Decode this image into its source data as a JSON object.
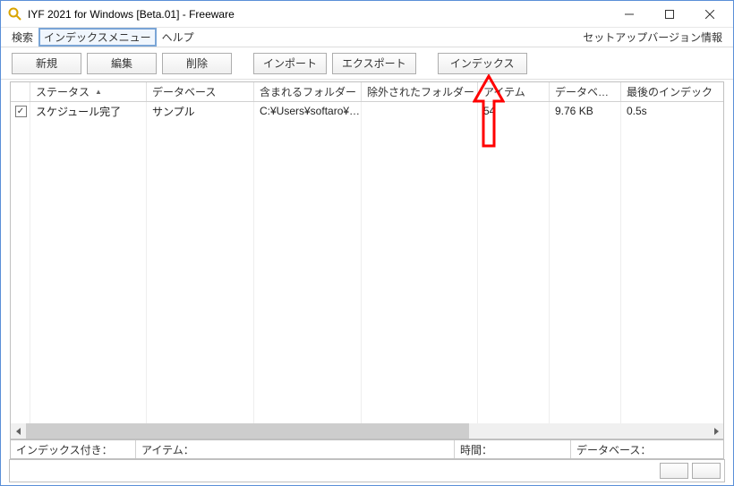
{
  "window": {
    "title": "IYF 2021 for Windows [Beta.01] - Freeware"
  },
  "menu": {
    "search": "検索",
    "index_menu": "インデックスメニュー",
    "help": "ヘルプ",
    "setup_version": "セットアップバージョン情報"
  },
  "toolbar": {
    "new": "新規",
    "edit": "編集",
    "delete": "削除",
    "import": "インポート",
    "export": "エクスポート",
    "index": "インデックス"
  },
  "columns": {
    "status": "ステータス",
    "database": "データベース",
    "included": "含まれるフォルダー",
    "excluded": "除外されたフォルダー",
    "items": "アイテム",
    "dbsize": "データベ…",
    "lastindex": "最後のインデック"
  },
  "row": {
    "checked": true,
    "status": "スケジュール完了",
    "database": "サンプル",
    "included": "C:¥Users¥softaro¥…",
    "excluded": "",
    "items": "54",
    "dbsize": "9.76 KB",
    "lastindex": "0.5s"
  },
  "statusbar": {
    "indexed_label": "インデックス付き：",
    "items_label": "アイテム：",
    "time_label": "時間：",
    "db_label": "データベース："
  }
}
